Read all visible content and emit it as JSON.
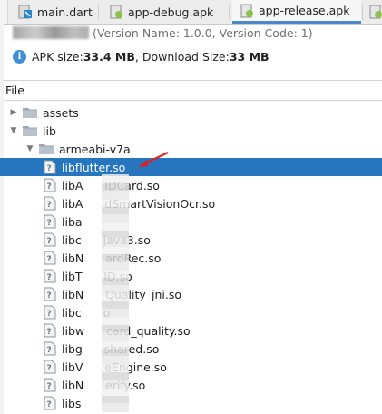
{
  "tabs": [
    {
      "label": "main.dart",
      "active": false,
      "icon": "dart-file-icon"
    },
    {
      "label": "app-debug.apk",
      "active": false,
      "icon": "apk-file-icon"
    },
    {
      "label": "app-release.apk",
      "active": true,
      "icon": "apk-file-icon"
    }
  ],
  "info": {
    "version_text": "(Version Name: 1.0.0, Version Code: 1)",
    "apk_size_label": "APK size: ",
    "apk_size_value": "33.4 MB",
    "download_label": ", Download Size: ",
    "download_value": "33 MB"
  },
  "tree": {
    "header": "File",
    "rows": [
      {
        "label": "assets",
        "type": "folder",
        "expanded": false
      },
      {
        "label": "lib",
        "type": "folder",
        "expanded": true
      },
      {
        "label": "armeabi-v7a",
        "type": "folder",
        "expanded": true
      },
      {
        "label": "libflutter.so",
        "type": "file",
        "selected": true
      },
      {
        "label": "libA      IDCard.so",
        "type": "file"
      },
      {
        "label": "libA      dSmartVisionOcr.so",
        "type": "file"
      },
      {
        "label": "liba",
        "type": "file"
      },
      {
        "label": "libc      java3.so",
        "type": "file"
      },
      {
        "label": "libN      ardRec.so",
        "type": "file"
      },
      {
        "label": "libT      ID.so",
        "type": "file"
      },
      {
        "label": "libN      Quality_jni.so",
        "type": "file"
      },
      {
        "label": "libc      o",
        "type": "file"
      },
      {
        "label": "libw      card_quality.so",
        "type": "file"
      },
      {
        "label": "libg      shared.so",
        "type": "file"
      },
      {
        "label": "libV      eEngine.so",
        "type": "file"
      },
      {
        "label": "libN      erify.so",
        "type": "file"
      },
      {
        "label": "libs",
        "type": "file"
      }
    ]
  },
  "colors": {
    "selection": "#2675bf",
    "annotation_arrow": "#e02020",
    "active_tab_underline": "#4a88c7"
  }
}
